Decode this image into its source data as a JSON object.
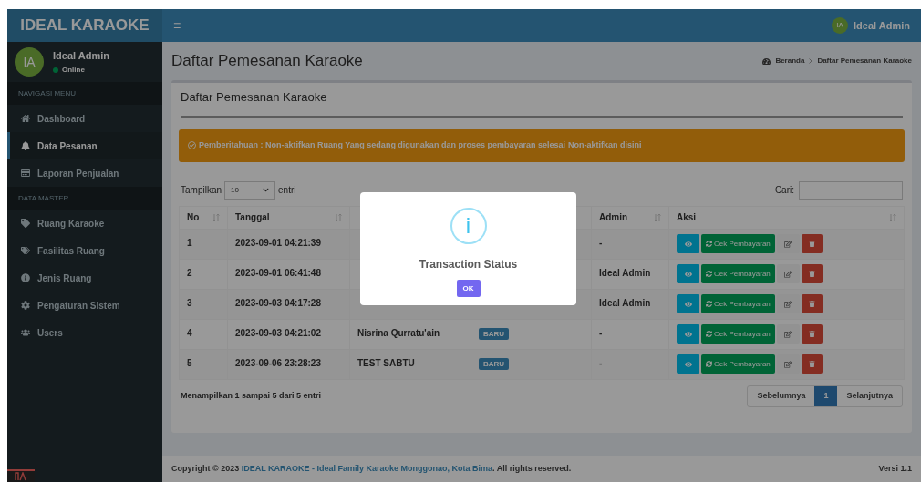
{
  "brand": "IDEAL KARAOKE",
  "topbar": {
    "menu_glyph": "≡",
    "user_initials": "IA",
    "user_name": "Ideal Admin"
  },
  "user_panel": {
    "initials": "IA",
    "name": "Ideal Admin",
    "status": "Online"
  },
  "sidebar": {
    "items": [
      {
        "kind": "header",
        "label": "NAVIGASI MENU"
      },
      {
        "kind": "link",
        "label": "Dashboard",
        "selected": false
      },
      {
        "kind": "link",
        "label": "Data Pesanan",
        "selected": true
      },
      {
        "kind": "link",
        "label": "Laporan Penjualan",
        "selected": false
      },
      {
        "kind": "header",
        "label": "DATA MASTER"
      },
      {
        "kind": "link",
        "label": "Ruang Karaoke",
        "selected": false
      },
      {
        "kind": "link",
        "label": "Fasilitas Ruang",
        "selected": false
      },
      {
        "kind": "link",
        "label": "Jenis Ruang",
        "selected": false
      },
      {
        "kind": "link",
        "label": "Pengaturan Sistem",
        "selected": false
      },
      {
        "kind": "link",
        "label": "Users",
        "selected": false
      }
    ]
  },
  "page_title": "Daftar Pemesanan Karaoke",
  "breadcrumb": [
    "Beranda",
    "Daftar Pemesanan Karaoke"
  ],
  "box_title": "Daftar Pemesanan Karaoke",
  "alert": {
    "text": "Pemberitahuan : Non-aktifkan Ruang Yang sedang digunakan dan proses pembayaran selesai",
    "link": "Non-aktifkan disini"
  },
  "length_control": {
    "label_before": "Tampilkan",
    "value": "10",
    "label_after": "entri"
  },
  "search": {
    "label": "Cari:"
  },
  "table": {
    "columns": [
      "No",
      "Tanggal",
      "",
      "",
      "Admin",
      "Aksi"
    ],
    "rows": [
      {
        "no": "1",
        "tanggal": "2023-09-01 04:21:39",
        "admin": "-",
        "action_label": "Cek Pembayaran"
      },
      {
        "no": "2",
        "tanggal": "2023-09-01 06:41:48",
        "admin": "Ideal Admin",
        "action_label": "Cek Pembayaran"
      },
      {
        "no": "3",
        "tanggal": "2023-09-03 04:17:28",
        "admin": "Ideal Admin",
        "action_label": "Cek Pembayaran"
      },
      {
        "no": "4",
        "tanggal": "2023-09-03 04:21:02",
        "nama": "Nisrina Qurratu'ain",
        "status": "BARU",
        "admin": "-",
        "action_label": "Cek Pembayaran"
      },
      {
        "no": "5",
        "tanggal": "2023-09-06 23:28:23",
        "nama": "TEST SABTU",
        "status": "BARU",
        "admin": "-",
        "action_label": "Cek Pembayaran"
      }
    ]
  },
  "table_info": "Menampilkan 1 sampai 5 dari 5 entri",
  "pagination": [
    {
      "label": "Sebelumnya",
      "selected": false
    },
    {
      "label": "1",
      "selected": true
    },
    {
      "label": "Selanjutnya",
      "selected": false
    }
  ],
  "footer": {
    "prefix": "Copyright © 2023",
    "link": "IDEAL KARAOKE - Ideal Family Karaoke Monggonao, Kota Bima",
    "suffix": ". All rights reserved.",
    "version": "Versi 1.1"
  },
  "modal": {
    "title": "Transaction Status",
    "icon_glyph": "i",
    "button": "OK"
  }
}
